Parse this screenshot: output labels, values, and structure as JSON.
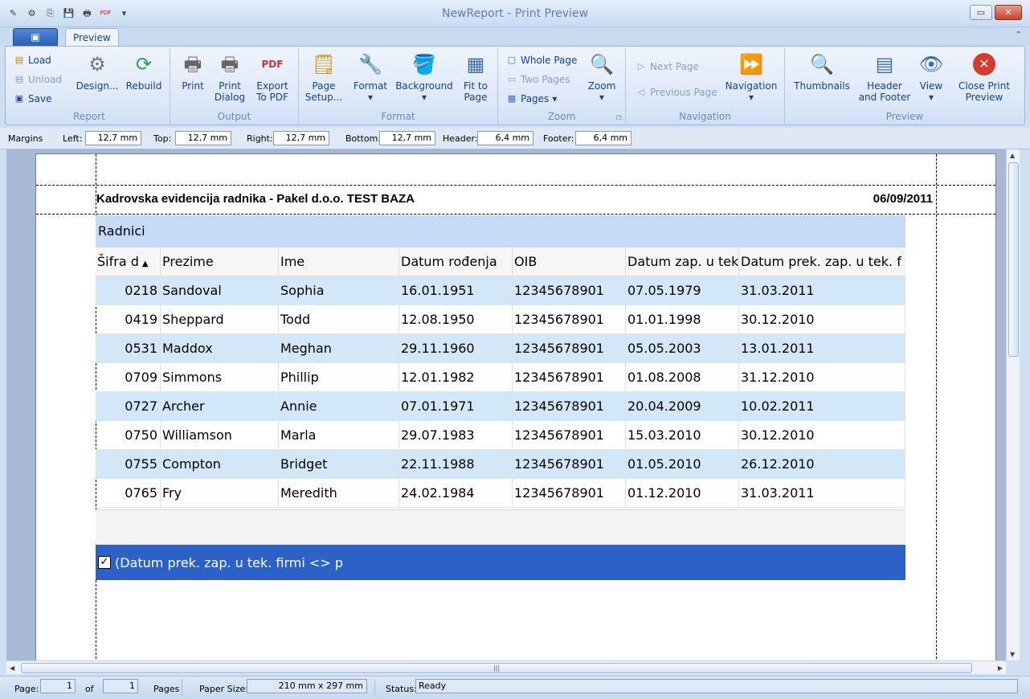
{
  "window": {
    "title": "NewReport - Print Preview",
    "min_label": "▭",
    "close_label": "✕"
  },
  "qat": [
    "✎",
    "⚙",
    "⎘",
    "💾",
    "🖶",
    "PDF",
    "▾"
  ],
  "tabs": {
    "active": "Preview",
    "collapse": "⌃"
  },
  "ribbon": {
    "report": {
      "label": "Report",
      "load": "Load",
      "unload": "Unload",
      "save": "Save",
      "design": "Design...",
      "rebuild": "Rebuild"
    },
    "output": {
      "label": "Output",
      "print": "Print",
      "print_dialog_1": "Print",
      "print_dialog_2": "Dialog",
      "export_1": "Export",
      "export_2": "To PDF"
    },
    "format": {
      "label": "Format",
      "page_setup_1": "Page",
      "page_setup_2": "Setup...",
      "format": "Format",
      "background": "Background",
      "fit_1": "Fit to",
      "fit_2": "Page"
    },
    "zoom": {
      "label": "Zoom",
      "whole": "Whole Page",
      "two": "Two Pages",
      "pages": "Pages",
      "zoom": "Zoom"
    },
    "navigation": {
      "label": "Navigation",
      "next": "Next Page",
      "prev": "Previous Page",
      "nav": "Navigation"
    },
    "preview": {
      "label": "Preview",
      "thumbs": "Thumbnails",
      "hf_1": "Header",
      "hf_2": "and Footer",
      "view": "View",
      "close_1": "Close Print",
      "close_2": "Preview"
    }
  },
  "margins": {
    "label": "Margins",
    "left_l": "Left:",
    "left": "12,7 mm",
    "top_l": "Top:",
    "top": "12,7 mm",
    "right_l": "Right:",
    "right": "12,7 mm",
    "bottom_l": "Bottom:",
    "bottom": "12,7 mm",
    "header_l": "Header:",
    "header": "6,4 mm",
    "footer_l": "Footer:",
    "footer": "6,4 mm"
  },
  "report": {
    "title": "Kadrovska evidencija radnika - Pakel d.o.o. TEST BAZA",
    "date": "06/09/2011",
    "caption": "Radnici",
    "columns": [
      "Šifra d",
      "Prezime",
      "Ime",
      "Datum rođenja",
      "OIB",
      "Datum zap. u tek",
      "Datum prek. zap. u tek. f"
    ],
    "rows": [
      [
        "0218",
        "Sandoval",
        "Sophia",
        "16.01.1951",
        "12345678901",
        "07.05.1979",
        "31.03.2011"
      ],
      [
        "0419",
        "Sheppard",
        "Todd",
        "12.08.1950",
        "12345678901",
        "01.01.1998",
        "30.12.2010"
      ],
      [
        "0531",
        "Maddox",
        "Meghan",
        "29.11.1960",
        "12345678901",
        "05.05.2003",
        "13.01.2011"
      ],
      [
        "0709",
        "Simmons",
        "Phillip",
        "12.01.1982",
        "12345678901",
        "01.08.2008",
        "31.12.2010"
      ],
      [
        "0727",
        "Archer",
        "Annie",
        "07.01.1971",
        "12345678901",
        "20.04.2009",
        "10.02.2011"
      ],
      [
        "0750",
        "Williamson",
        "Marla",
        "29.07.1983",
        "12345678901",
        "15.03.2010",
        "30.12.2010"
      ],
      [
        "0755",
        "Compton",
        "Bridget",
        "22.11.1988",
        "12345678901",
        "01.05.2010",
        "26.12.2010"
      ],
      [
        "0765",
        "Fry",
        "Meredith",
        "24.02.1984",
        "12345678901",
        "01.12.2010",
        "31.03.2011"
      ]
    ],
    "filter": "(Datum prek. zap. u tek. firmi <> p"
  },
  "status": {
    "page_l": "Page:",
    "page": "1",
    "of_l": "of",
    "of": "1",
    "pages_l": "Pages",
    "paper_l": "Paper Size:",
    "paper": "210 mm x 297 mm",
    "status_l": "Status:",
    "status": "Ready"
  }
}
